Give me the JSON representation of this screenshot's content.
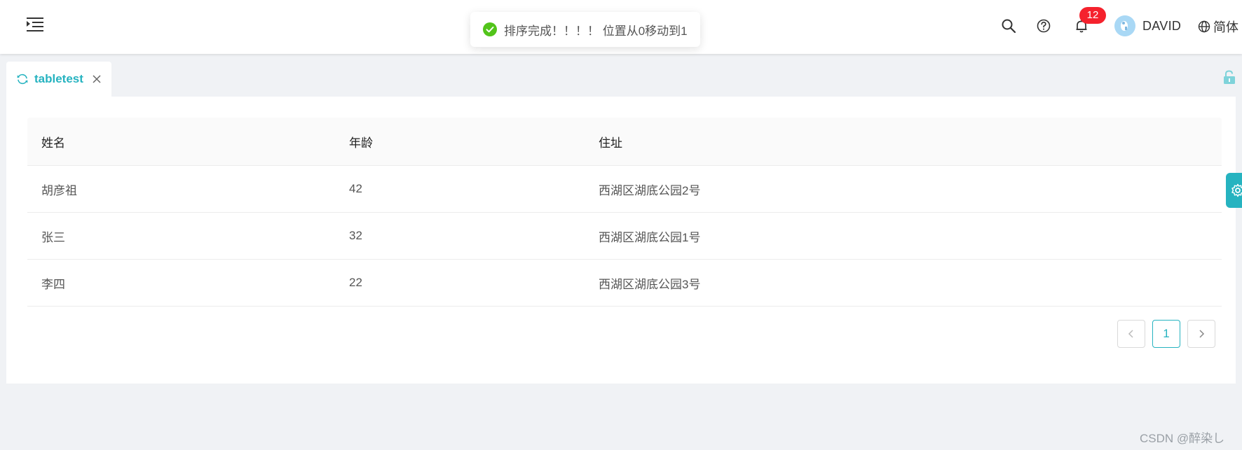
{
  "header": {
    "notification_count": "12",
    "username": "DAVID",
    "language": "简体"
  },
  "toast": {
    "message": "排序完成！！！！ 位置从0移动到1"
  },
  "tabs": [
    {
      "label": "tabletest"
    }
  ],
  "table": {
    "columns": [
      "姓名",
      "年龄",
      "住址"
    ],
    "rows": [
      [
        "胡彦祖",
        "42",
        "西湖区湖底公园2号"
      ],
      [
        "张三",
        "32",
        "西湖区湖底公园1号"
      ],
      [
        "李四",
        "22",
        "西湖区湖底公园3号"
      ]
    ]
  },
  "pagination": {
    "current_page": "1"
  },
  "watermark": "CSDN @醉染し",
  "colors": {
    "accent": "#26b3c0",
    "success": "#52c41a",
    "badge": "#f5222d"
  },
  "icons": [
    "menu-fold-icon",
    "search-icon",
    "question-icon",
    "bell-icon",
    "globe-icon",
    "sync-icon",
    "close-icon",
    "unlock-icon",
    "check-circle-icon",
    "gear-icon"
  ]
}
